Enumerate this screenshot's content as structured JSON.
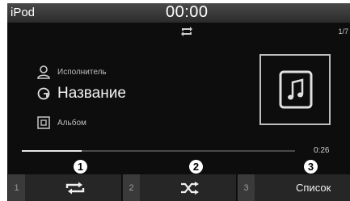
{
  "header": {
    "source": "iPod",
    "clock": "00:00"
  },
  "track": {
    "counter": "1/7",
    "artist": "Исполнитель",
    "title": "Название",
    "album": "Альбом"
  },
  "playback": {
    "progress": 0.22,
    "time_remaining": "0:26"
  },
  "softkeys": [
    {
      "number": "1",
      "icon": "repeat-icon",
      "callout": "1"
    },
    {
      "number": "2",
      "icon": "shuffle-icon",
      "callout": "2"
    },
    {
      "number": "3",
      "label": "Список",
      "callout": "3"
    }
  ],
  "colors": {
    "background": "#0d0d0d",
    "topbar": "#3a3a3a",
    "key": "#262626",
    "text": "#f0f0f0"
  }
}
